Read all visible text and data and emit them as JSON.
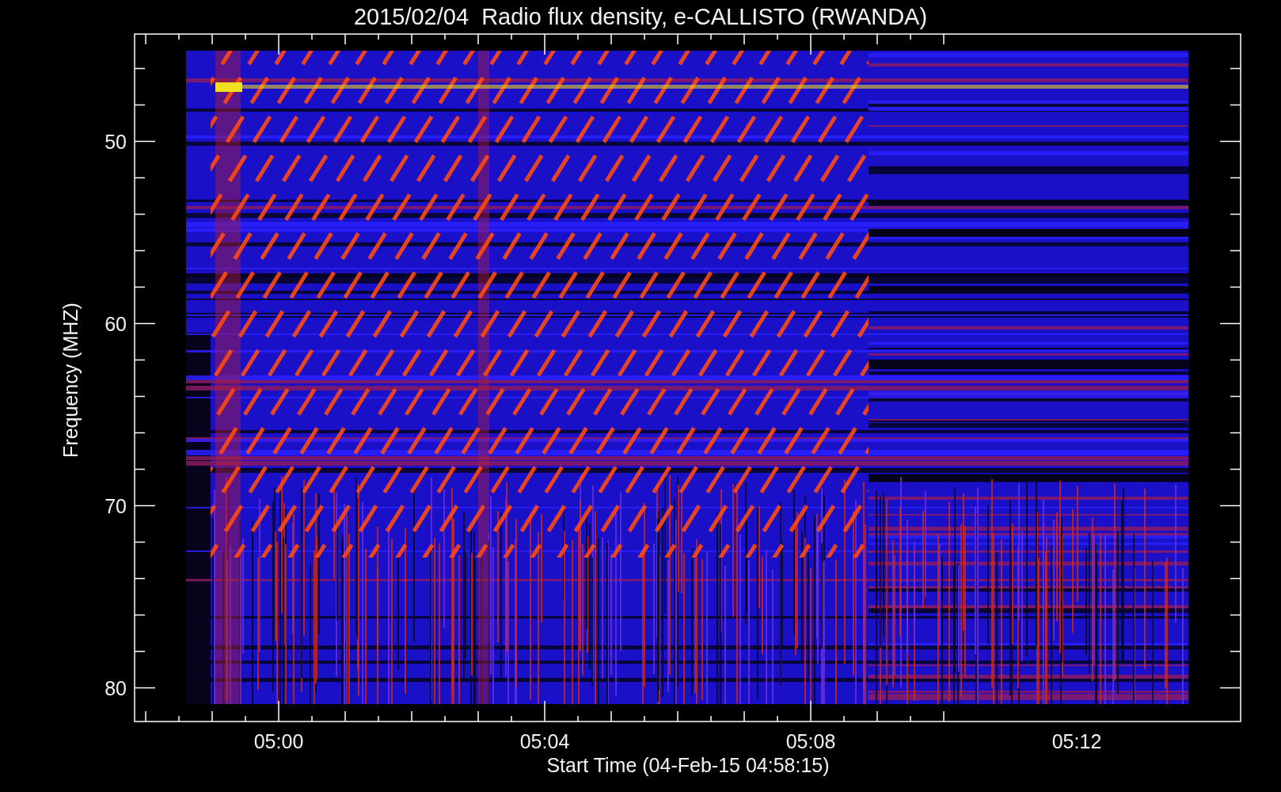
{
  "title": "2015/02/04  Radio flux density, e-CALLISTO (RWANDA)",
  "y_axis": {
    "label": "Frequency (MHZ)",
    "ticks": [
      "50",
      "60",
      "70",
      "80"
    ]
  },
  "x_axis": {
    "label": "Start Time (04-Feb-15 04:58:15)",
    "ticks": [
      "05:00",
      "05:04",
      "05:08",
      "05:12"
    ]
  }
}
